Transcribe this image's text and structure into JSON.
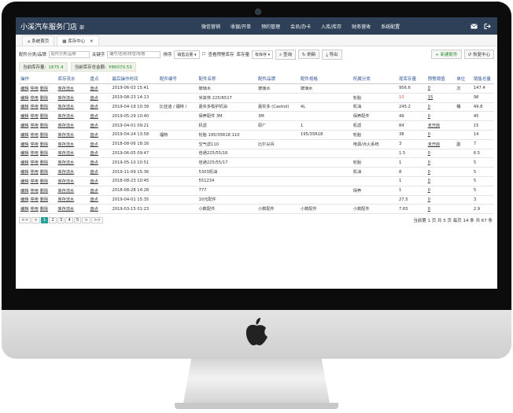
{
  "app": {
    "brand": "小溪汽车服务门店",
    "brand_suffix": "部",
    "menu": [
      "微信营销",
      "收银/开单",
      "预约管理",
      "会员/办卡",
      "入库/库存",
      "财务营收",
      "系统配置"
    ],
    "icons": [
      "mail-icon",
      "logout-icon"
    ]
  },
  "tabs": [
    {
      "label": "系统首页",
      "icon": "home-icon"
    },
    {
      "label": "库存中心",
      "icon": "grid-icon",
      "close": "✕"
    }
  ],
  "filters": {
    "category_label": "配件分类/品牌",
    "category_placeholder": "配件分类/品牌",
    "keyword_label": "关键字",
    "keyword_placeholder": "编号/名称/拼音/规格",
    "sort_label": "排序",
    "sort_value": "销售总量",
    "check_label": "查看预警库存",
    "stock_label": "库存量",
    "stock_value": "有库存",
    "search_btn": "查询",
    "refresh_btn": "刷新",
    "export_btn": "导出",
    "new_part_btn": "+ 新建配件",
    "restore_btn": "恢复中心"
  },
  "stats": {
    "stock_label": "当前库存量:",
    "stock_value": "1875.4",
    "total_label": "当前库存总金额:",
    "total_value": "¥86070.53"
  },
  "table": {
    "headers": [
      "操作",
      "库存流水",
      "盘点",
      "最后操作时间",
      "配件编号",
      "配件名称",
      "配件品牌",
      "配件规格",
      "所属分类",
      "现库存量",
      "预警阈值",
      "单位",
      "销售总量"
    ],
    "action_labels": [
      "编辑",
      "停用",
      "删除"
    ],
    "flow_label": "库存流水",
    "count_label": "盘点",
    "rows": [
      {
        "time": "2019-06-03 15:41",
        "code": "",
        "name": "玻璃水",
        "brand": "玻璃水",
        "spec": "玻璃水",
        "cat": "",
        "stock": "956.6",
        "warn": "0",
        "unit": "次",
        "sales": "147.4"
      },
      {
        "time": "2019-08-23 14:13",
        "code": "",
        "name": "米其林 225/R517",
        "brand": "",
        "spec": "",
        "cat": "轮胎",
        "stock": "10",
        "warn": "15",
        "unit": "",
        "sales": "98",
        "stock_red": true
      },
      {
        "time": "2019-04-18 10:39",
        "code": "比亚迪 / 福特 /",
        "name": "嘉实多极护机油",
        "brand": "嘉实多 (Castrol)",
        "spec": "4L",
        "cat": "机油",
        "stock": "245.2",
        "warn": "0",
        "unit": "桶",
        "sales": "49.8"
      },
      {
        "time": "2019-05-29 10:40",
        "code": "",
        "name": "保养配件 3M",
        "brand": "3M",
        "spec": "",
        "cat": "保养配件",
        "stock": "49",
        "warn": "0",
        "unit": "",
        "sales": "45"
      },
      {
        "time": "2019-04-01 09:21",
        "code": "",
        "name": "机滤",
        "brand": "原厂",
        "spec": "1",
        "cat": "机滤",
        "stock": "84",
        "warn": "未开启",
        "unit": "",
        "sales": "15"
      },
      {
        "time": "2019-04-24 13:58",
        "code": "福特",
        "name": "轮胎 195/35R18 110",
        "brand": "",
        "spec": "195/35R18",
        "cat": "轮胎",
        "stock": "38",
        "warn": "0",
        "unit": "",
        "sales": "14"
      },
      {
        "time": "2018-08-06 18:16",
        "code": "",
        "name": "空气滤110",
        "brand": "比尔尖兵",
        "spec": "",
        "cat": "电源/点火系统",
        "stock": "3",
        "warn": "未开启",
        "unit": "副",
        "sales": "7"
      },
      {
        "time": "2019-06-05 09:47",
        "code": "",
        "name": "佳通225/55/16",
        "brand": "",
        "spec": "",
        "cat": "",
        "stock": "1.5",
        "warn": "0",
        "unit": "",
        "sales": "6.5"
      },
      {
        "time": "2019-05-10 10:51",
        "code": "",
        "name": "佳通225/55/17",
        "brand": "",
        "spec": "",
        "cat": "轮胎",
        "stock": "1",
        "warn": "0",
        "unit": "",
        "sales": "5"
      },
      {
        "time": "2019-11-09 15:36",
        "code": "",
        "name": "5303机油",
        "brand": "",
        "spec": "",
        "cat": "机油",
        "stock": "8",
        "warn": "0",
        "unit": "",
        "sales": "5"
      },
      {
        "time": "2018-08-23 10:45",
        "code": "",
        "name": "551234",
        "brand": "",
        "spec": "",
        "cat": "",
        "stock": "1",
        "warn": "0",
        "unit": "",
        "sales": "5"
      },
      {
        "time": "2018-08-28 14:28",
        "code": "",
        "name": "777",
        "brand": "",
        "spec": "",
        "cat": "保养",
        "stock": "1",
        "warn": "0",
        "unit": "",
        "sales": "5"
      },
      {
        "time": "2019-04-01 15:35",
        "code": "",
        "name": "10元配件",
        "brand": "",
        "spec": "",
        "cat": "",
        "stock": "27.5",
        "warn": "0",
        "unit": "",
        "sales": "3"
      },
      {
        "time": "2019-03-15 01:23",
        "code": "",
        "name": "小数配件",
        "brand": "小数配件",
        "spec": "小数配件",
        "cat": "小数配件",
        "stock": "7.65",
        "warn": "0",
        "unit": "",
        "sales": "2.9"
      }
    ]
  },
  "pager": {
    "buttons": [
      "<<",
      "<",
      "1",
      "2",
      "3",
      "4",
      "5",
      ">",
      ">>"
    ],
    "current": "1",
    "info": "当前第 1 页 共 5 页 每页 14 条 共 67 条"
  },
  "colors": {
    "nav": "#2e4057",
    "accent": "#2aa198",
    "green": "#2a8f2a",
    "header_text": "#2f5597",
    "alert": "#d9534f"
  }
}
